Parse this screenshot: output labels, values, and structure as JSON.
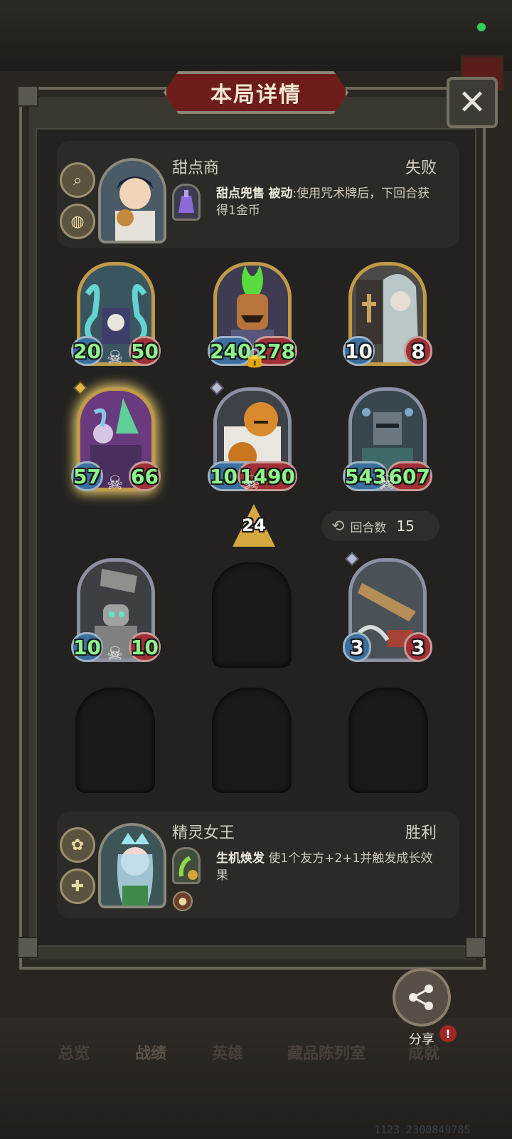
{
  "header": {
    "title": "本局详情",
    "close_icon": "close-icon"
  },
  "opponent": {
    "name": "甜点商",
    "result": "失败",
    "skill_name": "甜点兜售",
    "skill_type": "被动",
    "skill_desc": ":使用咒术牌后，下回合获得1金币"
  },
  "player": {
    "name": "精灵女王",
    "result": "胜利",
    "skill_name": "生机焕发",
    "skill_desc": "使1个友方+2+1并触发成长效果"
  },
  "board": {
    "minions": [
      {
        "attack": "20",
        "health": "50",
        "frame": "gold"
      },
      {
        "attack": "240",
        "health": "278",
        "frame": "gold"
      },
      {
        "attack": "10",
        "health": "8",
        "frame": "gold"
      },
      {
        "attack": "57",
        "health": "66",
        "frame": "gold-glow"
      },
      {
        "attack": "1068",
        "health": "1490",
        "frame": "silver"
      },
      {
        "attack": "543",
        "health": "607",
        "frame": "silver"
      },
      {
        "attack": "10",
        "health": "10",
        "frame": "silver"
      },
      {
        "attack": "3",
        "health": "3",
        "frame": "silver"
      }
    ],
    "tier": "24",
    "rounds_label": "回合数",
    "rounds_value": "15"
  },
  "share": {
    "label": "分享",
    "badge": "!"
  },
  "nav": {
    "items": [
      "总览",
      "战绩",
      "英雄",
      "藏品陈列室",
      "成就"
    ],
    "active": "战绩"
  },
  "uid": "1123 2300849785",
  "colors": {
    "title_ribbon": "#6e1c1b",
    "gold_frame": "#c09a47",
    "silver_frame": "#8d8fa2",
    "stat_green": "#8ef58a",
    "status_dot": "#2fd05a"
  }
}
